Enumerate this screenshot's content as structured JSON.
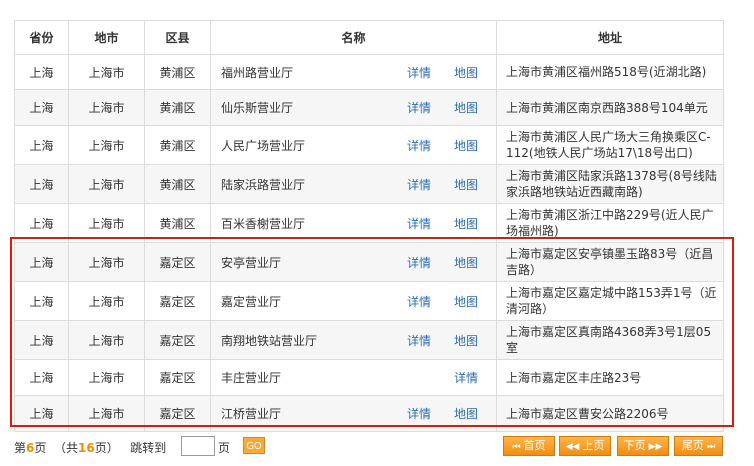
{
  "headers": {
    "province": "省份",
    "city": "地市",
    "district": "区县",
    "name": "名称",
    "address": "地址"
  },
  "rows": [
    {
      "province": "上海",
      "city": "上海市",
      "district": "黄浦区",
      "name": "福州路营业厅",
      "detail": "详情",
      "map": "地图",
      "address": "上海市黄浦区福州路518号(近湖北路)"
    },
    {
      "province": "上海",
      "city": "上海市",
      "district": "黄浦区",
      "name": "仙乐斯营业厅",
      "detail": "详情",
      "map": "地图",
      "address": "上海市黄浦区南京西路388号104单元"
    },
    {
      "province": "上海",
      "city": "上海市",
      "district": "黄浦区",
      "name": "人民广场营业厅",
      "detail": "详情",
      "map": "地图",
      "address": "上海市黄浦区人民广场大三角换乘区C-112(地铁人民广场站17\\18号出口)"
    },
    {
      "province": "上海",
      "city": "上海市",
      "district": "黄浦区",
      "name": "陆家浜路营业厅",
      "detail": "详情",
      "map": "地图",
      "address": "上海市黄浦区陆家浜路1378号(8号线陆家浜路地铁站近西藏南路)"
    },
    {
      "province": "上海",
      "city": "上海市",
      "district": "黄浦区",
      "name": "百米香榭营业厅",
      "detail": "详情",
      "map": "地图",
      "address": "上海市黄浦区浙江中路229号(近人民广场福州路)"
    },
    {
      "province": "上海",
      "city": "上海市",
      "district": "嘉定区",
      "name": "安亭营业厅",
      "detail": "详情",
      "map": "地图",
      "address": "上海市嘉定区安亭镇墨玉路83号（近昌吉路）"
    },
    {
      "province": "上海",
      "city": "上海市",
      "district": "嘉定区",
      "name": "嘉定营业厅",
      "detail": "详情",
      "map": "地图",
      "address": "上海市嘉定区嘉定城中路153弄1号（近清河路）"
    },
    {
      "province": "上海",
      "city": "上海市",
      "district": "嘉定区",
      "name": "南翔地铁站营业厅",
      "detail": "详情",
      "map": "地图",
      "address": "上海市嘉定区真南路4368弄3号1层05室"
    },
    {
      "province": "上海",
      "city": "上海市",
      "district": "嘉定区",
      "name": "丰庄营业厅",
      "detail": "",
      "map": "详情",
      "address": "上海市嘉定区丰庄路23号"
    },
    {
      "province": "上海",
      "city": "上海市",
      "district": "嘉定区",
      "name": "江桥营业厅",
      "detail": "详情",
      "map": "地图",
      "address": "上海市嘉定区曹安公路2206号"
    }
  ],
  "pager": {
    "prefix": "第",
    "current": "6",
    "page_word": "页",
    "total_prefix": "（共",
    "total": "16",
    "total_suffix": "页）",
    "jump_label": "跳转到",
    "jump_value": "",
    "jump_suffix": "页",
    "go": "GO",
    "first": "首页",
    "prev": "上页",
    "next": "下页",
    "last": "尾页"
  },
  "colors": {
    "link": "#2a6ebb",
    "highlight": "#d81e06",
    "accent": "#f08c00"
  }
}
